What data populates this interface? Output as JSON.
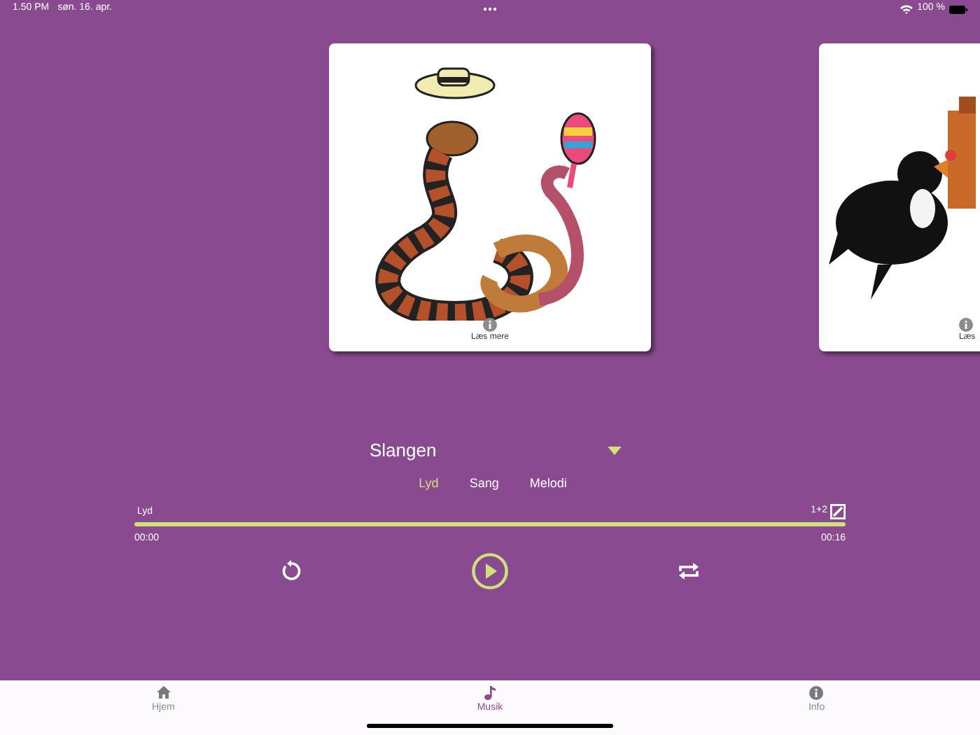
{
  "status_bar": {
    "time": "1.50 PM",
    "date": "søn. 16. apr.",
    "battery": "100 %"
  },
  "cards": [
    {
      "kind": "picture",
      "caption": "Læs mere"
    },
    {
      "kind": "picture",
      "caption": "Læs"
    }
  ],
  "song": {
    "title": "Slangen"
  },
  "modes": [
    {
      "label": "Lyd",
      "selected": true
    },
    {
      "label": "Sang",
      "selected": false
    },
    {
      "label": "Melodi",
      "selected": false
    }
  ],
  "player": {
    "track_label": "Lyd",
    "voice_label": "1+2",
    "elapsed": "00:00",
    "duration": "00:16"
  },
  "tab_bar": [
    {
      "label": "Hjem",
      "kind": "home",
      "selected": false
    },
    {
      "label": "Musik",
      "kind": "music",
      "selected": true
    },
    {
      "label": "Info",
      "kind": "info",
      "selected": false
    }
  ]
}
